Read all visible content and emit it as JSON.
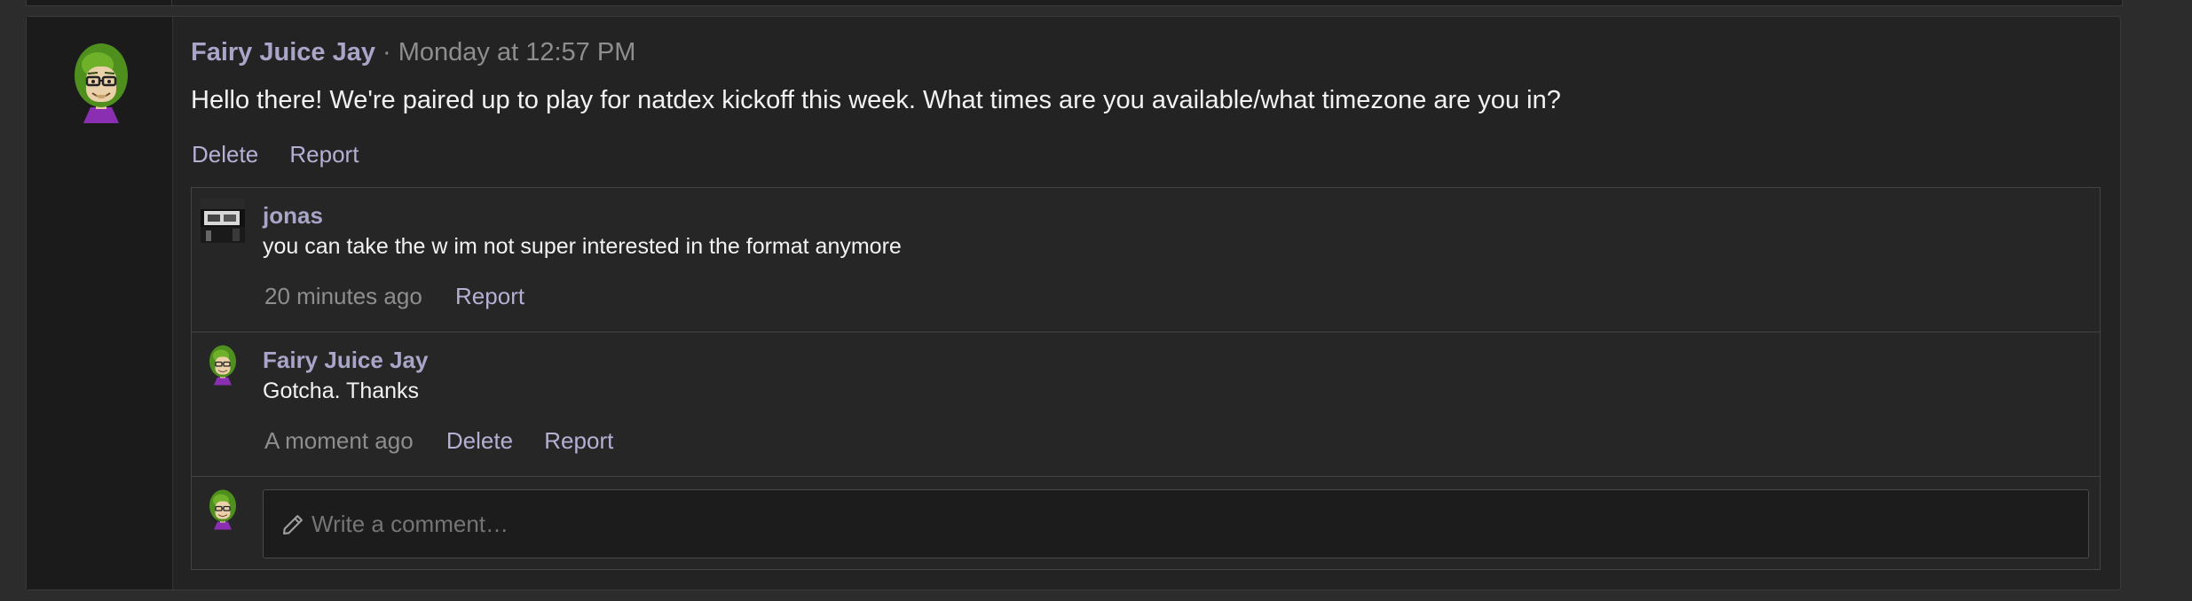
{
  "post": {
    "author": "Fairy Juice Jay",
    "separator": " · ",
    "timestamp": "Monday at 12:57 PM",
    "text": "Hello there! We're paired up to play for natdex kickoff this week. What times are you available/what timezone are you in?",
    "actions": {
      "delete": "Delete",
      "report": "Report"
    }
  },
  "comments": [
    {
      "author": "jonas",
      "text": "you can take the w im not super interested in the format anymore",
      "time": "20 minutes ago",
      "report": "Report"
    },
    {
      "author": "Fairy Juice Jay",
      "text": "Gotcha. Thanks",
      "time": "A moment ago",
      "delete": "Delete",
      "report": "Report"
    }
  ],
  "reply": {
    "placeholder": "Write a comment…"
  },
  "colors": {
    "background": "#2c2c2c",
    "card": "#232323",
    "author": "#a9a5c8",
    "link": "#b4b0d4",
    "muted": "#8e8e8e",
    "text": "#f2f2f2"
  },
  "icons": {
    "main_avatar": "cartoon-avatar-icon",
    "jonas_avatar": "photo-avatar-icon",
    "reply_field": "pencil-icon"
  }
}
